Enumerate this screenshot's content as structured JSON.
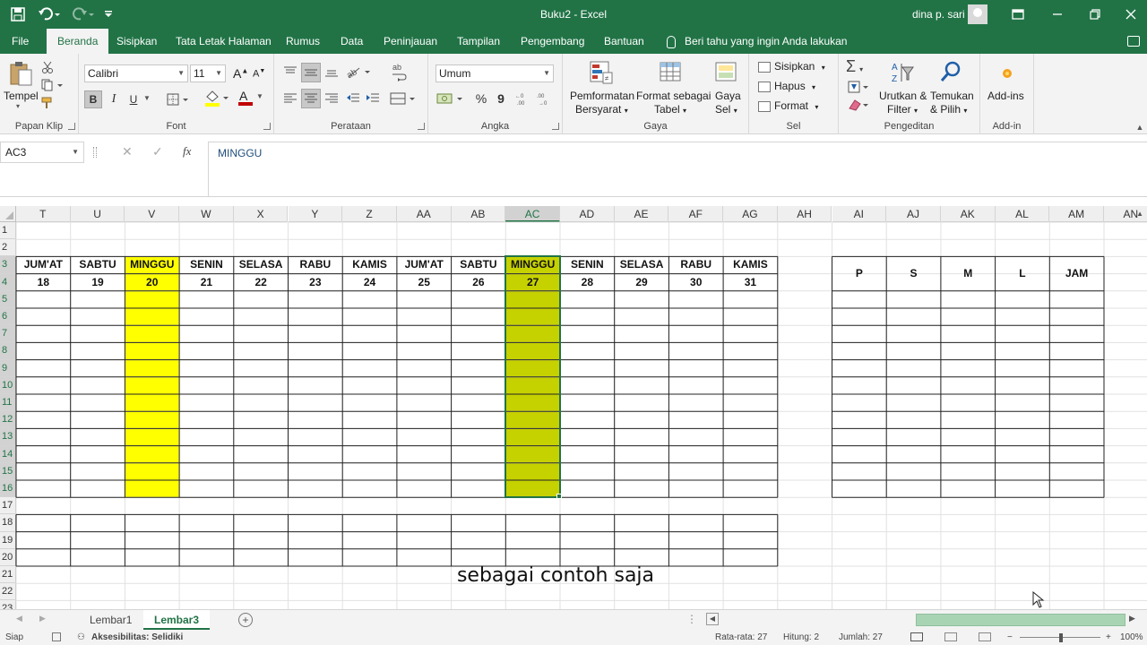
{
  "window": {
    "title": "Buku2  -  Excel",
    "user": "dina p. sari",
    "min_icon": "minimize-icon",
    "max_icon": "restore-icon",
    "close_icon": "close-icon"
  },
  "tabs": {
    "file": "File",
    "home": "Beranda",
    "insert": "Sisipkan",
    "layout": "Tata Letak Halaman",
    "formulas": "Rumus",
    "data": "Data",
    "review": "Peninjauan",
    "view": "Tampilan",
    "developer": "Pengembang",
    "help": "Bantuan",
    "tell_me": "Beri tahu yang ingin Anda lakukan"
  },
  "ribbon": {
    "clipboard": {
      "paste": "Tempel",
      "label": "Papan Klip"
    },
    "font": {
      "name": "Calibri",
      "size": "11",
      "bold": "B",
      "italic": "I",
      "underline": "U",
      "grow": "A",
      "shrink": "A",
      "font_color": "A",
      "label": "Font"
    },
    "alignment": {
      "label": "Perataan",
      "wrap": "ab"
    },
    "number": {
      "format": "Umum",
      "percent": "%",
      "comma": "9",
      "label": "Angka"
    },
    "styles": {
      "conditional_1": "Pemformatan",
      "conditional_2": "Bersyarat",
      "table_1": "Format sebagai",
      "table_2": "Tabel",
      "cell_1": "Gaya",
      "cell_2": "Sel",
      "label": "Gaya"
    },
    "cells": {
      "insert": "Sisipkan",
      "delete": "Hapus",
      "format": "Format",
      "label": "Sel"
    },
    "editing": {
      "sort_1": "Urutkan &",
      "sort_2": "Filter",
      "find_1": "Temukan",
      "find_2": "& Pilih",
      "sigma": "Σ",
      "label": "Pengeditan"
    },
    "addins": {
      "button": "Add-ins",
      "label": "Add-in"
    }
  },
  "formula_bar": {
    "name_box": "AC3",
    "cancel": "✕",
    "enter": "✓",
    "fx": "fx",
    "content": "MINGGU"
  },
  "sheet": {
    "columns": [
      "T",
      "U",
      "V",
      "W",
      "X",
      "Y",
      "Z",
      "AA",
      "AB",
      "AC",
      "AD",
      "AE",
      "AF",
      "AG",
      "AH",
      "AI",
      "AJ",
      "AK",
      "AL",
      "AM",
      "AN"
    ],
    "rows": [
      "1",
      "2",
      "3",
      "4",
      "5",
      "6",
      "7",
      "8",
      "9",
      "10",
      "11",
      "12",
      "13",
      "14",
      "15",
      "16",
      "17",
      "18",
      "19",
      "20",
      "21",
      "22",
      "23"
    ],
    "days": [
      "JUM'AT",
      "SABTU",
      "MINGGU",
      "SENIN",
      "SELASA",
      "RABU",
      "KAMIS",
      "JUM'AT",
      "SABTU",
      "MINGGU",
      "SENIN",
      "SELASA",
      "RABU",
      "KAMIS"
    ],
    "dates": [
      "18",
      "19",
      "20",
      "21",
      "22",
      "23",
      "24",
      "25",
      "26",
      "27",
      "28",
      "29",
      "30",
      "31"
    ],
    "summary_headers": [
      "P",
      "S",
      "M",
      "L",
      "JAM"
    ],
    "highlight_colors": {
      "sunday": "#ffff00",
      "sunday_selected": "#c6d100",
      "accent": "#217346"
    },
    "overlay_caption": "sebagai contoh saja"
  },
  "sheet_tabs": {
    "tabs": [
      "Lembar1",
      "Lembar3"
    ],
    "active": "Lembar3",
    "add": "+"
  },
  "status": {
    "ready": "Siap",
    "accessibility": "Aksesibilitas: Selidiki",
    "average": "Rata-rata: 27",
    "count": "Hitung: 2",
    "sum": "Jumlah: 27",
    "zoom": "100%"
  }
}
